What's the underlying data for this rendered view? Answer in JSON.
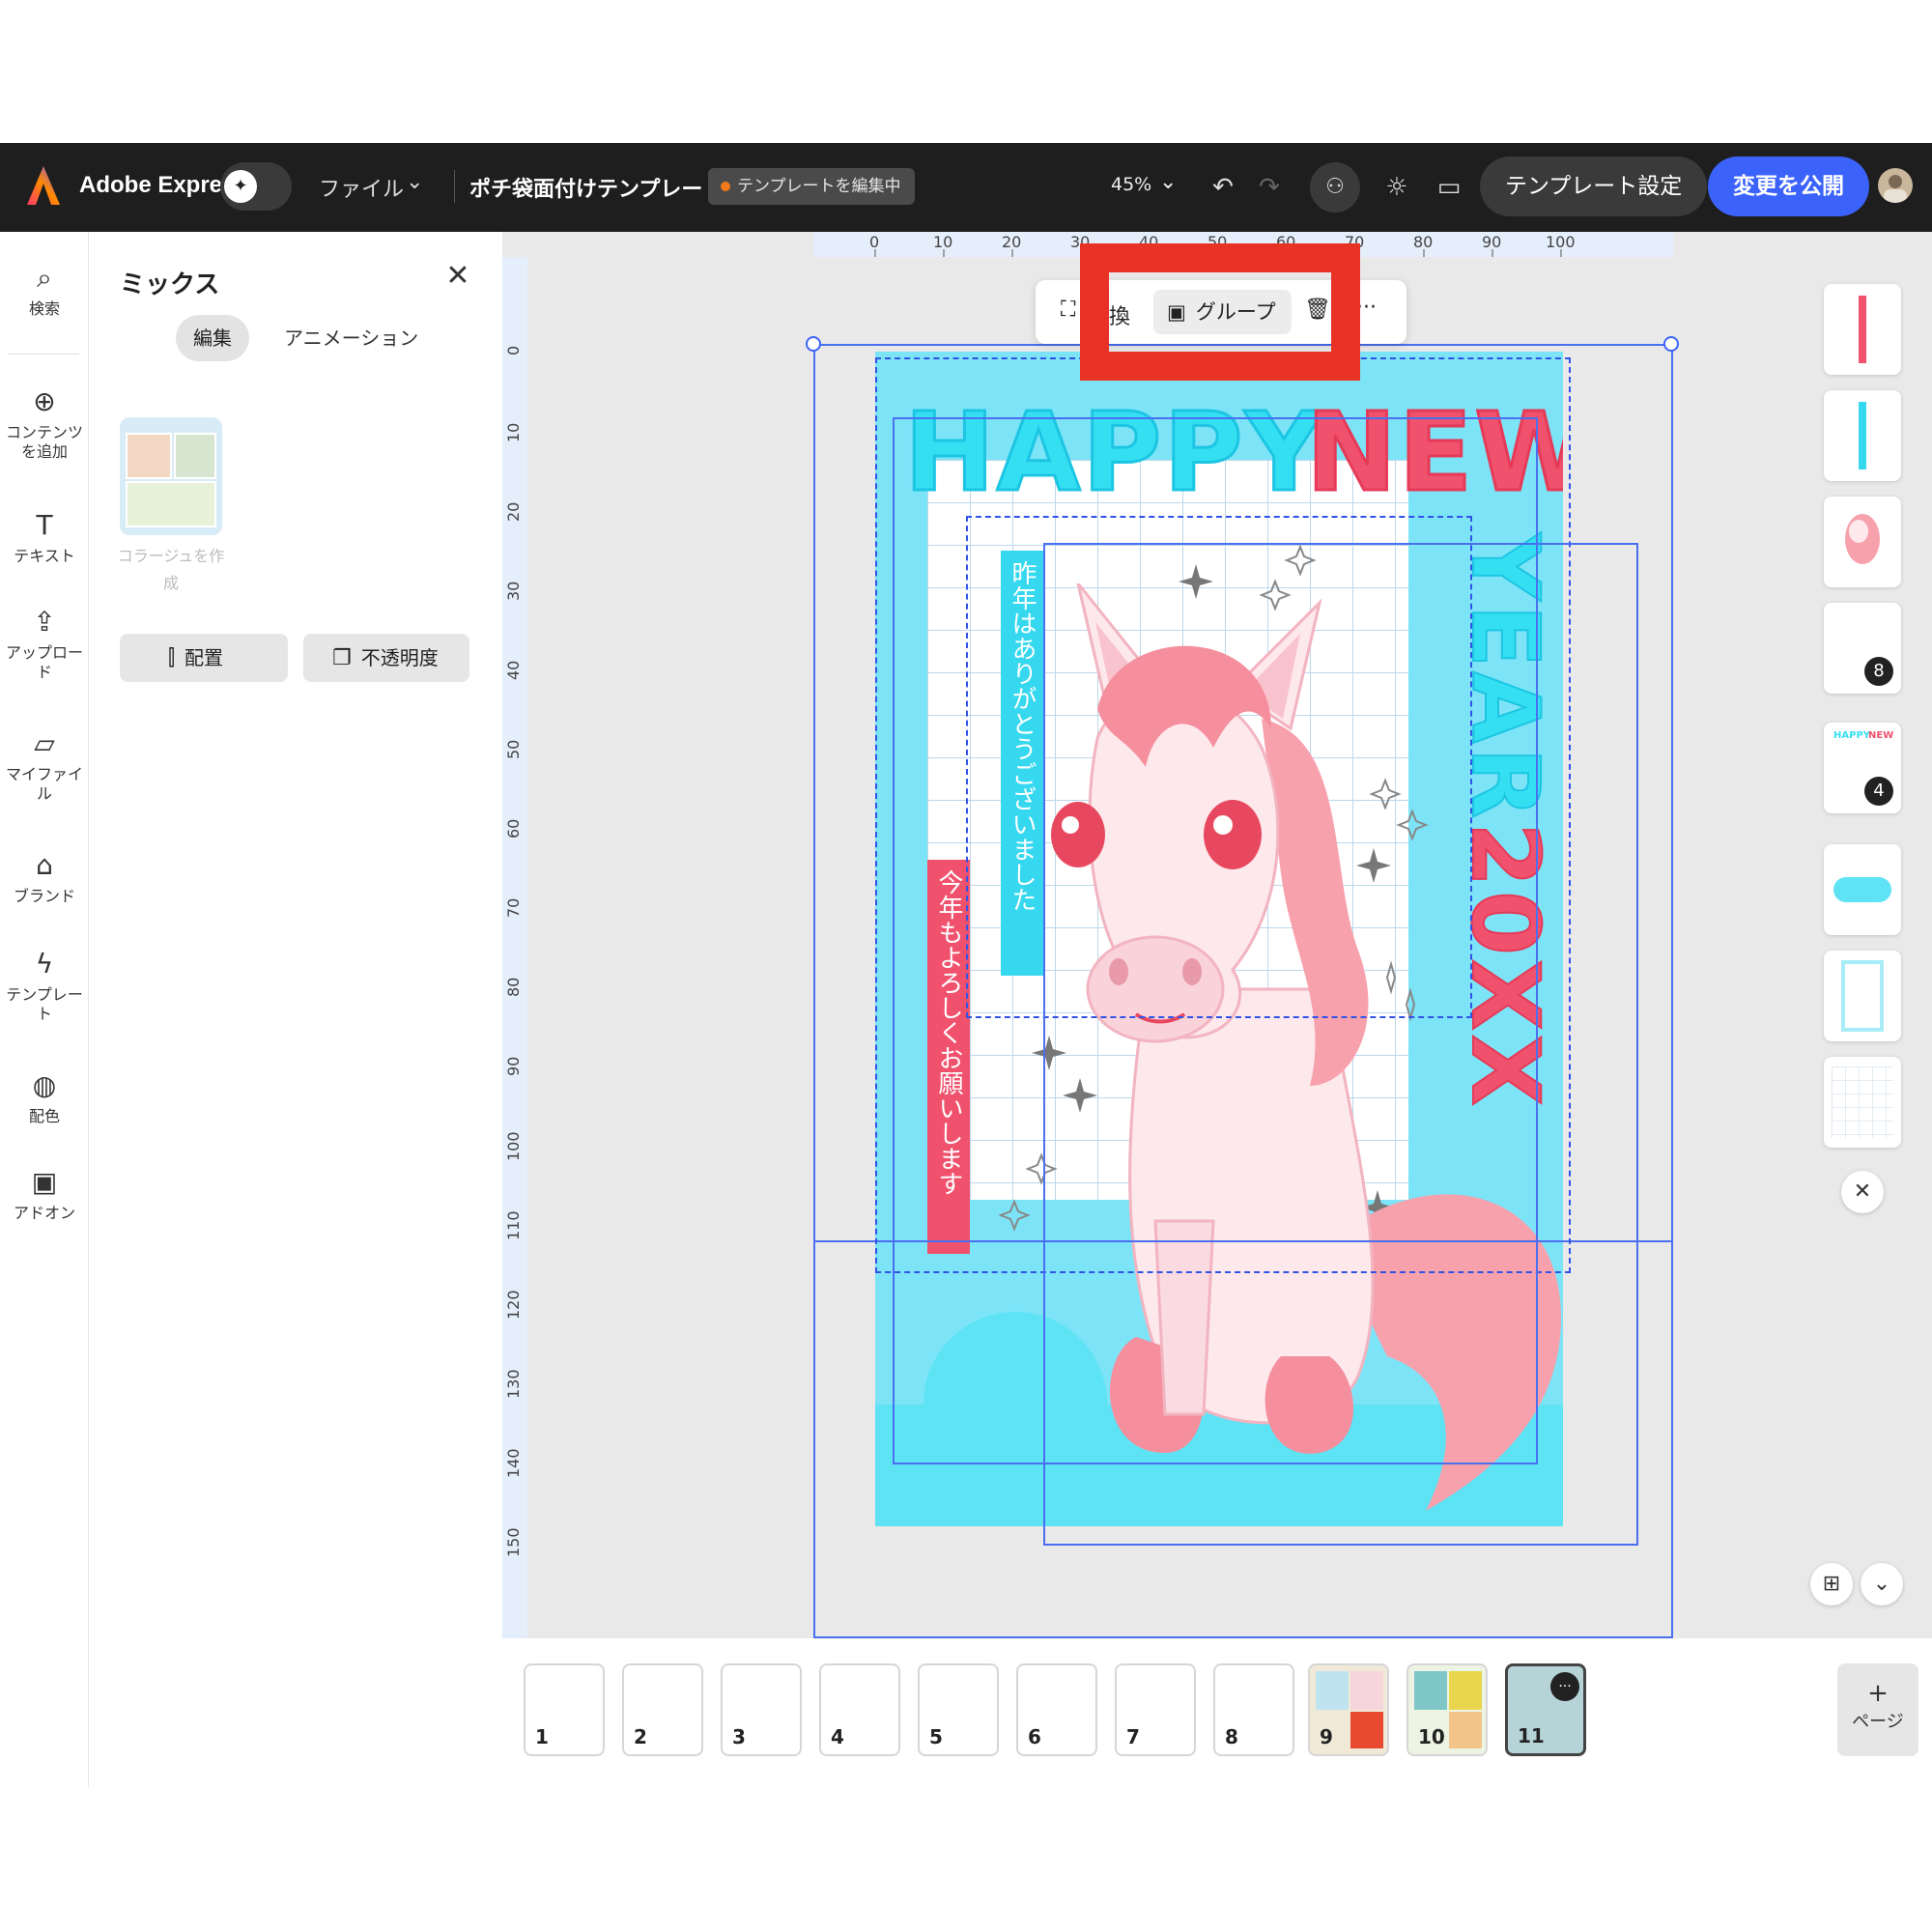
{
  "topbar": {
    "app_name": "Adobe Express",
    "file_menu": "ファイル",
    "doc_title": "ポチ袋面付けテンプレート",
    "edit_status": "テンプレートを編集中",
    "zoom": "45%",
    "template_settings": "テンプレート設定",
    "publish": "変更を公開",
    "icons": [
      "adobe-express-logo",
      "magic-toggle",
      "chevron-down-icon",
      "undo-icon",
      "redo-icon",
      "collaborator-icon",
      "lightbulb-icon",
      "comment-icon",
      "user-avatar"
    ]
  },
  "rail": {
    "items": [
      {
        "icon": "search-icon",
        "label": "検索"
      },
      {
        "icon": "plus-circle-icon",
        "label": "コンテンツを追加"
      },
      {
        "icon": "text-icon",
        "label": "テキスト"
      },
      {
        "icon": "upload-icon",
        "label": "アップロード"
      },
      {
        "icon": "folder-icon",
        "label": "マイファイル"
      },
      {
        "icon": "brand-icon",
        "label": "ブランド"
      },
      {
        "icon": "template-icon",
        "label": "テンプレート"
      },
      {
        "icon": "palette-icon",
        "label": "配色"
      },
      {
        "icon": "addon-icon",
        "label": "アドオン"
      }
    ]
  },
  "panel": {
    "title": "ミックス",
    "tab_edit": "編集",
    "tab_animation": "アニメーション",
    "collage_label": "コラージュを作成",
    "arrange": "配置",
    "opacity": "不透明度"
  },
  "toolbar": {
    "replace_fragment": "換",
    "group": "グループ",
    "more": "···"
  },
  "ruler": {
    "top": [
      "0",
      "10",
      "20",
      "30",
      "40",
      "50",
      "60",
      "70",
      "80",
      "90",
      "100"
    ],
    "left": [
      "0",
      "10",
      "20",
      "30",
      "40",
      "50",
      "60",
      "70",
      "80",
      "90",
      "100",
      "110",
      "120",
      "130",
      "140",
      "150"
    ]
  },
  "design": {
    "happy": "HAPPY",
    "new": "NEW",
    "year": "YEAR",
    "year_num": "20XX",
    "thanks": "昨年はありがとうございました",
    "regards": "今年もよろしくお願いします"
  },
  "right_rail": {
    "badge_a": "8",
    "badge_b": "4",
    "mini_happy": "HAPPY",
    "mini_new": "NEW"
  },
  "pages": {
    "thumbs": [
      "1",
      "2",
      "3",
      "4",
      "5",
      "6",
      "7",
      "8",
      "9",
      "10",
      "11"
    ],
    "active": "11",
    "add_page": "ページ",
    "add_plus": "+"
  },
  "colors": {
    "accent": "#3b63fb",
    "cyan": "#35dff2",
    "pink": "#f0526e",
    "highlight": "#e83225"
  }
}
